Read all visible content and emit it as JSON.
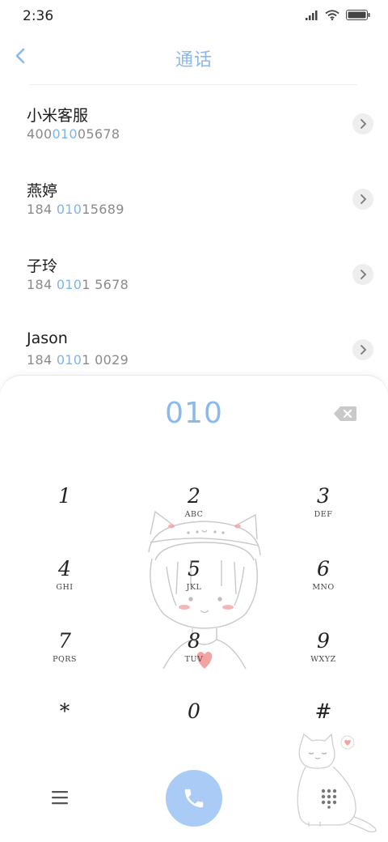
{
  "status_bar": {
    "time": "2:36"
  },
  "header": {
    "title": "通话"
  },
  "results": [
    {
      "name": "小米客服",
      "number_pre": "400",
      "number_match": "010",
      "number_post": "05678"
    },
    {
      "name": "燕婷",
      "number_pre": "184 ",
      "number_match": "010",
      "number_post": "15689"
    },
    {
      "name": "子玲",
      "number_pre": "184 ",
      "number_match": "010",
      "number_post": "1 5678"
    },
    {
      "name": "Jason",
      "number_pre": "184 ",
      "number_match": "010",
      "number_post": "1 0029"
    }
  ],
  "dialer": {
    "input": "010",
    "keys": [
      {
        "digit": "1",
        "letters": ""
      },
      {
        "digit": "2",
        "letters": "ABC"
      },
      {
        "digit": "3",
        "letters": "DEF"
      },
      {
        "digit": "4",
        "letters": "GHI"
      },
      {
        "digit": "5",
        "letters": "JKL"
      },
      {
        "digit": "6",
        "letters": "MNO"
      },
      {
        "digit": "7",
        "letters": "PQRS"
      },
      {
        "digit": "8",
        "letters": "TUV"
      },
      {
        "digit": "9",
        "letters": "WXYZ"
      },
      {
        "digit": "*",
        "letters": ""
      },
      {
        "digit": "0",
        "letters": ""
      },
      {
        "digit": "#",
        "letters": ""
      }
    ]
  },
  "icons": {
    "back": "chevron-left-icon",
    "backspace": "backspace-icon",
    "call": "phone-icon",
    "menu": "menu-icon",
    "keypad": "dialpad-icon"
  },
  "colors": {
    "accent": "#8ab8ef",
    "call_button": "#a9cbf5",
    "match": "#7eb3ec"
  }
}
